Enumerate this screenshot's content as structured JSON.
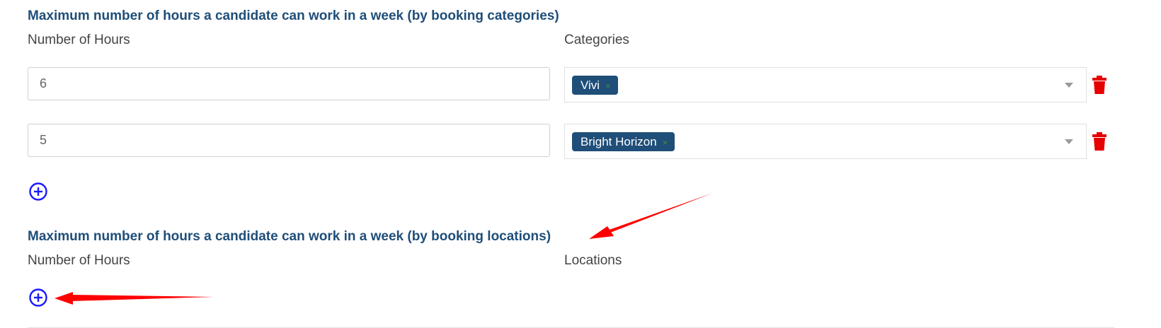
{
  "categories_section": {
    "title": "Maximum number of hours a candidate can work in a week (by booking categories)",
    "hours_label": "Number of Hours",
    "categories_label": "Categories",
    "rows": [
      {
        "hours": "6",
        "tag": "Vivi",
        "tag_remove": "×"
      },
      {
        "hours": "5",
        "tag": "Bright Horizon",
        "tag_remove": "×"
      }
    ]
  },
  "locations_section": {
    "title": "Maximum number of hours a candidate can work in a week (by booking locations)",
    "hours_label": "Number of Hours",
    "locations_label": "Locations"
  },
  "colors": {
    "title": "#1f4e79",
    "tag_bg": "#1f4e79",
    "delete": "#e60000",
    "add": "#1a1aff",
    "annotation_arrow": "#ff0000"
  },
  "icons": {
    "delete": "trash-icon",
    "add": "plus-circle-icon",
    "dropdown": "caret-down-icon"
  }
}
